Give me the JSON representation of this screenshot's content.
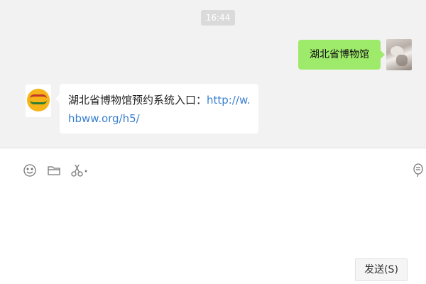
{
  "chat": {
    "timestamp": "16:44",
    "sent_message": "湖北省博物馆",
    "received_message": {
      "text": "湖北省博物馆预约系统入口：",
      "link": "http://w.hbww.org/h5/"
    }
  },
  "toolbar": {
    "icons": [
      "emoji-icon",
      "folder-icon",
      "scissors-icon",
      "chat-bubble-icon"
    ]
  },
  "input": {
    "value": ""
  },
  "send_button": {
    "label": "发送(S)"
  },
  "colors": {
    "chat_background": "#f2f2f2",
    "sent_bubble": "#9eea6a",
    "received_bubble": "#ffffff",
    "link": "#3a7fd0",
    "timestamp_badge": "#dadada"
  }
}
